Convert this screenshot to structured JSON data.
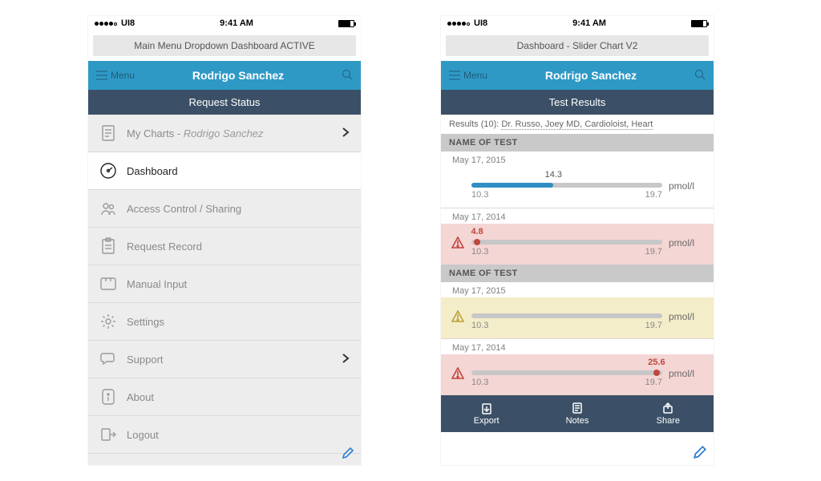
{
  "statusbar": {
    "carrier": "UI8",
    "time": "9:41 AM"
  },
  "left": {
    "chip": "Main Menu Dropdown Dashboard ACTIVE",
    "menu_label": "Menu",
    "user": "Rodrigo Sanchez",
    "subheader": "Request Status",
    "items": [
      {
        "label_prefix": "My Charts - ",
        "label_suffix": "Rodrigo Sanchez",
        "chevron": true
      },
      {
        "label": "Dashboard"
      },
      {
        "label": "Access Control / Sharing"
      },
      {
        "label": "Request Record"
      },
      {
        "label": "Manual Input"
      },
      {
        "label": "Settings"
      },
      {
        "label": "Support",
        "chevron": true
      },
      {
        "label": "About"
      },
      {
        "label": "Logout"
      }
    ]
  },
  "right": {
    "chip": "Dashboard - Slider Chart V2",
    "menu_label": "Menu",
    "user": "Rodrigo Sanchez",
    "subheader": "Test Results",
    "meta_prefix": "Results (10): ",
    "meta_links": "Dr. Russo, Joey MD, Cardioloist, Heart",
    "section": "NAME OF TEST",
    "unit": "pmol/l",
    "toolbar": {
      "export": "Export",
      "notes": "Notes",
      "share": "Share"
    },
    "rows": [
      {
        "date": "May 17, 2015",
        "value": "14.3",
        "min": "10.3",
        "max": "19.7"
      },
      {
        "date": "May 17, 2014",
        "value": "4.8",
        "min": "10.3",
        "max": "19.7"
      },
      {
        "date": "May 17, 2015",
        "value": "",
        "min": "10.3",
        "max": "19.7"
      },
      {
        "date": "May 17, 2014",
        "value": "25.6",
        "min": "10.3",
        "max": "19.7"
      }
    ]
  },
  "chart_data": [
    {
      "type": "bar",
      "title": "Test result slider",
      "categories": [
        "May 17, 2015"
      ],
      "values": [
        14.3
      ],
      "ylim": [
        10.3,
        19.7
      ],
      "ylabel": "pmol/l"
    },
    {
      "type": "bar",
      "title": "Test result slider",
      "categories": [
        "May 17, 2014"
      ],
      "values": [
        4.8
      ],
      "ylim": [
        10.3,
        19.7
      ],
      "ylabel": "pmol/l"
    },
    {
      "type": "bar",
      "title": "Test result slider",
      "categories": [
        "May 17, 2015"
      ],
      "values": [
        null
      ],
      "ylim": [
        10.3,
        19.7
      ],
      "ylabel": "pmol/l"
    },
    {
      "type": "bar",
      "title": "Test result slider",
      "categories": [
        "May 17, 2014"
      ],
      "values": [
        25.6
      ],
      "ylim": [
        10.3,
        19.7
      ],
      "ylabel": "pmol/l"
    }
  ]
}
